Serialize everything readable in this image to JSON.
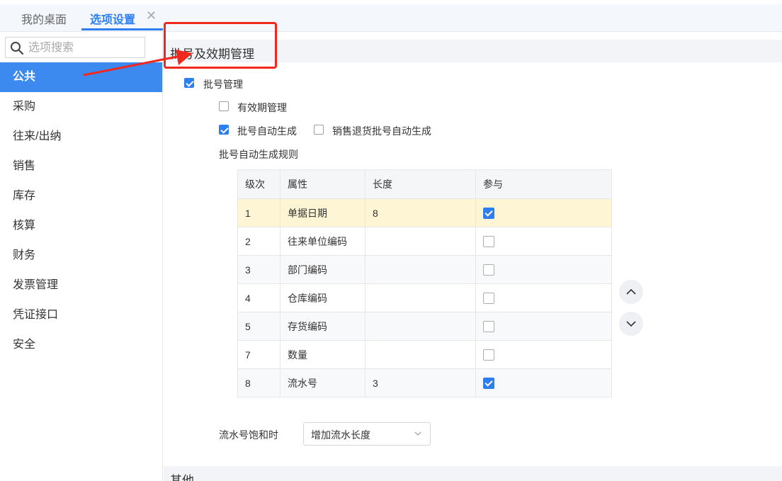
{
  "tabs": {
    "home_label": "我的桌面",
    "active_label": "选项设置",
    "close_glyph": "✕"
  },
  "sidebar": {
    "search_placeholder": "选项搜索",
    "items": [
      {
        "label": "公共",
        "active": true
      },
      {
        "label": "采购"
      },
      {
        "label": "往来/出纳"
      },
      {
        "label": "销售"
      },
      {
        "label": "库存"
      },
      {
        "label": "核算"
      },
      {
        "label": "财务"
      },
      {
        "label": "发票管理"
      },
      {
        "label": "凭证接口"
      },
      {
        "label": "安全"
      }
    ]
  },
  "main": {
    "section_title": "批号及效期管理",
    "batch_mgmt": {
      "label": "批号管理",
      "checked": true
    },
    "expiry_mgmt": {
      "label": "有效期管理",
      "checked": false
    },
    "auto_gen": {
      "label": "批号自动生成",
      "checked": true
    },
    "sales_return_auto_gen": {
      "label": "销售退货批号自动生成",
      "checked": false
    },
    "rules_label": "批号自动生成规则",
    "table": {
      "headers": [
        "级次",
        "属性",
        "长度",
        "参与"
      ],
      "rows": [
        {
          "level": "1",
          "attr": "单据日期",
          "length": "8",
          "participate": true
        },
        {
          "level": "2",
          "attr": "往来单位编码",
          "length": "",
          "participate": false
        },
        {
          "level": "3",
          "attr": "部门编码",
          "length": "",
          "participate": false
        },
        {
          "level": "4",
          "attr": "仓库编码",
          "length": "",
          "participate": false
        },
        {
          "level": "5",
          "attr": "存货编码",
          "length": "",
          "participate": false
        },
        {
          "level": "7",
          "attr": "数量",
          "length": "",
          "participate": false
        },
        {
          "level": "8",
          "attr": "流水号",
          "length": "3",
          "participate": true
        }
      ]
    },
    "saturation_label": "流水号饱和时",
    "saturation_value": "增加流水长度",
    "other_section_title": "其他"
  },
  "colors": {
    "accent": "#2d7ff0",
    "sidebar_active_bg": "#3c8af0",
    "selected_row_bg": "#fdf5d3",
    "annotation_red": "#f0281e"
  }
}
